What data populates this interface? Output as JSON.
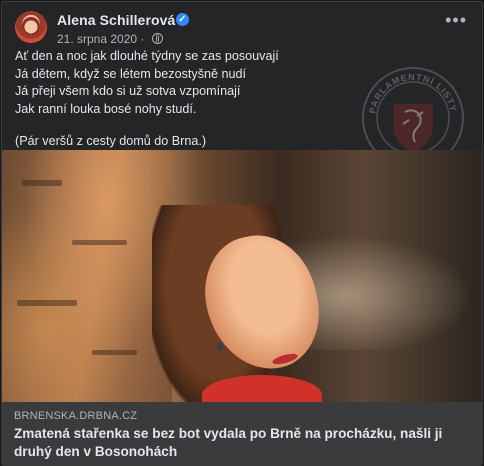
{
  "post": {
    "author": "Alena Schillerová",
    "date": "21. srpna 2020",
    "dot": "·",
    "more_label": "•••",
    "verified_mark": "✓",
    "lines": [
      "Ať den a noc jak dlouhé týdny se zas posouvají",
      "Já dětem, když se létem bezostyšně nudí",
      "Já přeji všem kdo si už sotva vzpomínají",
      "Jak ranní louka bosé nohy studí.",
      "(Pár veršů z cesty domů do Brna.)"
    ],
    "watermark_text": "PARLAMENTNÍ LISTY"
  },
  "link": {
    "domain": "BRNENSKA.DRBNA.CZ",
    "headline": "Zmatená stařenka se bez bot vydala po Brně na procházku, našli ji druhý den v Bosonohách"
  },
  "icons": [
    "globe-icon",
    "verified-icon",
    "more-options-icon"
  ],
  "colors": {
    "card_bg": "#242526",
    "link_bg": "#3a3b3c",
    "text_primary": "#e4e6eb",
    "text_secondary": "#b0b3b8",
    "verified": "#2d88ff"
  }
}
